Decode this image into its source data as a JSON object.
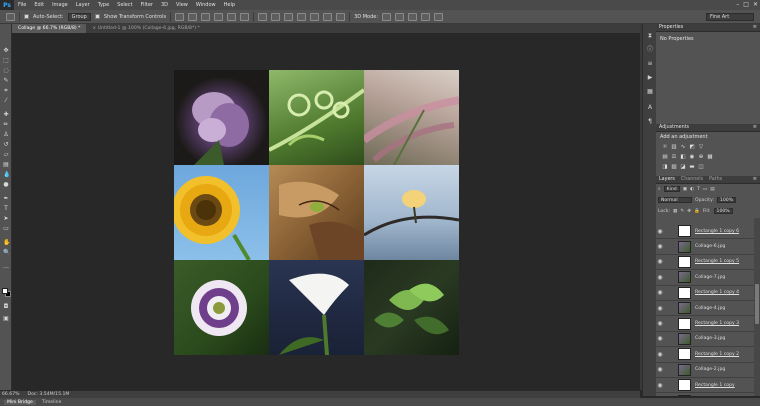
{
  "app": {
    "logo": "Ps"
  },
  "menu": [
    "File",
    "Edit",
    "Image",
    "Layer",
    "Type",
    "Select",
    "Filter",
    "3D",
    "View",
    "Window",
    "Help"
  ],
  "window_controls": [
    "–",
    "□",
    "✕"
  ],
  "options": {
    "auto_select_label": "Auto-Select:",
    "auto_select_value": "Group",
    "show_transform_label": "Show Transform Controls",
    "mode_3d_label": "3D Mode:",
    "workspace": "Fine Art"
  },
  "tabs": [
    {
      "label": "Collage @ 66.7% (RGB/8) *",
      "active": true
    },
    {
      "label": "× Untitled-1 @ 100% (Collage-6.jpg, RGB/8*) *",
      "active": false
    }
  ],
  "status": {
    "zoom": "66.67%",
    "doc": "Doc: 3.54M/15.1M"
  },
  "bottom_tabs": [
    {
      "label": "Mini Bridge",
      "active": true
    },
    {
      "label": "Timeline",
      "active": false
    }
  ],
  "panels": {
    "properties": {
      "header": "Properties",
      "text": "No Properties"
    },
    "adjustments": {
      "header": "Adjustments",
      "title": "Add an adjustment"
    },
    "layers": {
      "tabs": [
        "Layers",
        "Channels",
        "Paths"
      ],
      "filter_kind": "Kind",
      "blend_mode": "Normal",
      "opacity_label": "Opacity:",
      "opacity_value": "100%",
      "lock_label": "Lock:",
      "fill_label": "Fill:",
      "fill_value": "100%",
      "items": [
        {
          "name": "Rectangle 1 copy 6",
          "thumb": "shape",
          "underline": true
        },
        {
          "name": "Collage-6.jpg",
          "thumb": "image",
          "underline": false
        },
        {
          "name": "Rectangle 1 copy 5",
          "thumb": "shape",
          "underline": true
        },
        {
          "name": "Collage-7.jpg",
          "thumb": "image",
          "underline": false
        },
        {
          "name": "Rectangle 1 copy 4",
          "thumb": "shape",
          "underline": true
        },
        {
          "name": "Collage-4.jpg",
          "thumb": "image",
          "underline": false
        },
        {
          "name": "Rectangle 1 copy 3",
          "thumb": "shape",
          "underline": true
        },
        {
          "name": "Collage-3.jpg",
          "thumb": "image",
          "underline": false
        },
        {
          "name": "Rectangle 1 copy 2",
          "thumb": "shape",
          "underline": true
        },
        {
          "name": "Collage-2.jpg",
          "thumb": "image",
          "underline": false
        },
        {
          "name": "Rectangle 1 copy",
          "thumb": "shape",
          "underline": true
        },
        {
          "name": "Collage-1.jpg",
          "thumb": "image",
          "underline": false
        }
      ]
    }
  },
  "colors": {
    "menubar": "#4a4a4a",
    "panel": "#535353",
    "workspace": "#282828",
    "accent_logo": "#31a8ff"
  }
}
